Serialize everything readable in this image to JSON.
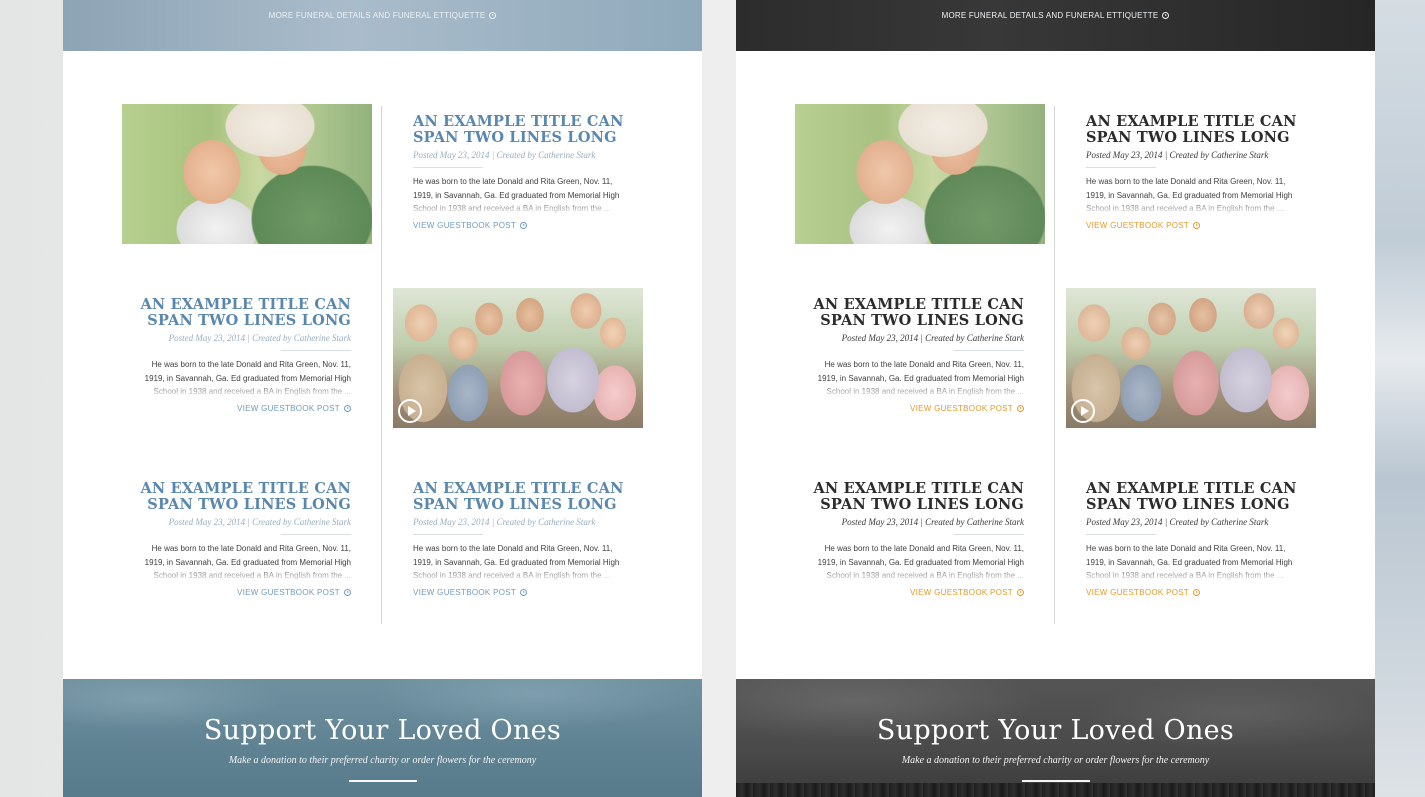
{
  "top_link": "MORE FUNERAL DETAILS AND FUNERAL ETTIQUETTE",
  "post": {
    "title": "AN EXAMPLE TITLE CAN SPAN TWO LINES LONG",
    "meta": "Posted May 23, 2014 | Created by Catherine Stark",
    "excerpt": "He was born to the late Donald and Rita Green, Nov. 11, 1919, in Savannah, Ga. Ed graduated from Memorial High School in 1938 and received a BA in English from the ...",
    "link": "VIEW GUESTBOOK POST"
  },
  "support": {
    "title": "Support Your Loved Ones",
    "subtitle": "Make a donation to their preferred charity or order flowers for the ceremony"
  },
  "colors": {
    "blue_accent": "#5a87ad",
    "dark_title": "#2b2b2b",
    "orange_link": "#e39a2e"
  },
  "icons": [
    "circle-arrow-icon",
    "play-icon"
  ]
}
